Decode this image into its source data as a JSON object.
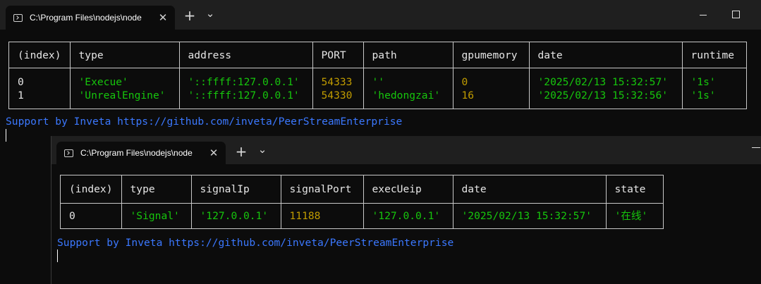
{
  "window1": {
    "tab_title": "C:\\Program Files\\nodejs\\node",
    "new_tab_glyph": "+",
    "dropdown_glyph": "⌄",
    "table": {
      "headers": [
        "(index)",
        "type",
        "address",
        "PORT",
        "path",
        "gpumemory",
        "date",
        "runtime"
      ],
      "rows": [
        [
          "0",
          "'Execue'",
          "'::ffff:127.0.0.1'",
          "54333",
          "''",
          "0",
          "'2025/02/13 15:32:57'",
          "'1s'"
        ],
        [
          "1",
          "'UnrealEngine'",
          "'::ffff:127.0.0.1'",
          "54330",
          "'hedongzai'",
          "16",
          "'2025/02/13 15:32:56'",
          "'1s'"
        ]
      ]
    },
    "support_text": "Support by Inveta https://github.com/inveta/PeerStreamEnterprise"
  },
  "window2": {
    "tab_title": "C:\\Program Files\\nodejs\\node",
    "new_tab_glyph": "+",
    "dropdown_glyph": "⌄",
    "table": {
      "headers": [
        "(index)",
        "type",
        "signalIp",
        "signalPort",
        "execUeip",
        "date",
        "state"
      ],
      "rows": [
        [
          "0",
          "'Signal'",
          "'127.0.0.1'",
          "11188",
          "'127.0.0.1'",
          "'2025/02/13 15:32:57'",
          "'在线'"
        ]
      ]
    },
    "support_text": "Support by Inveta https://github.com/inveta/PeerStreamEnterprise"
  },
  "colors": {
    "background": "#0c0c0c",
    "string_green": "#16c60c",
    "number_orange": "#c19c00",
    "link_blue": "#3b78ff",
    "text": "#e6e6e6"
  },
  "icons": [
    "terminal-icon",
    "close-icon",
    "plus-icon",
    "chevron-down-icon",
    "minimize-icon",
    "maximize-icon"
  ]
}
